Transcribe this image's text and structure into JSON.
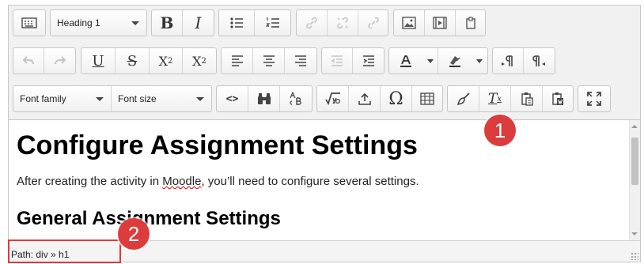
{
  "toolbar": {
    "block_format": "Heading 1",
    "font_family": "Font family",
    "font_size": "Font size",
    "bold_label": "B",
    "italic_label": "I",
    "underline_label": "U",
    "strike_label": "S",
    "subscript_label": "X",
    "subscript_sub": "2",
    "superscript_label": "X",
    "superscript_sup": "2",
    "clear_format_label": "T",
    "clear_format_sub": "x",
    "omega_label": "Ω",
    "code_label": "<>"
  },
  "content": {
    "heading": "Configure Assignment Settings",
    "para_before": "After creating the activity in ",
    "para_link": "Moodle",
    "para_after": ", you’ll need to configure several settings.",
    "subheading": "General Assignment Settings"
  },
  "status": {
    "path": "Path: div » h1"
  },
  "markers": {
    "m1": "1",
    "m2": "2"
  },
  "colors": {
    "marker": "#dd3c3c",
    "toolbar_bg": "#f1f1f1"
  }
}
